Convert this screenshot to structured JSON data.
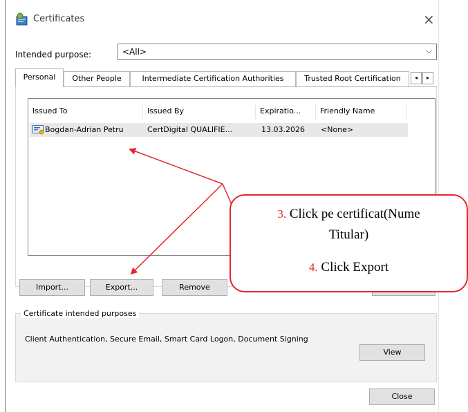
{
  "window": {
    "title": "Certificates",
    "close_glyph": "×"
  },
  "purpose": {
    "label": "Intended purpose:",
    "value": "<All>",
    "chevron": "⌵"
  },
  "tabs": [
    {
      "label": "Personal",
      "active": true
    },
    {
      "label": "Other People",
      "active": false
    },
    {
      "label": "Intermediate Certification Authorities",
      "active": false
    },
    {
      "label": "Trusted Root Certification",
      "active": false
    }
  ],
  "tab_scroll": {
    "left": "◂",
    "right": "▸"
  },
  "list": {
    "columns": [
      "Issued To",
      "Issued By",
      "Expiratio...",
      "Friendly Name"
    ],
    "rows": [
      {
        "issued_to": "Bogdan-Adrian Petru",
        "issued_by": "CertDigital QUALIFIE...",
        "expiration": "13.03.2026",
        "friendly_name": "<None>",
        "icon": "certificate-icon"
      }
    ]
  },
  "buttons": {
    "import": "Import...",
    "export": "Export...",
    "remove": "Remove",
    "view": "View",
    "close": "Close"
  },
  "purposes_group": {
    "legend": "Certificate intended purposes",
    "text": "Client Authentication, Secure Email, Smart Card Logon, Document Signing"
  },
  "callout": {
    "step3_num": "3.",
    "step3_text_a": "Click pe certificat(Nume",
    "step3_text_b": "Titular)",
    "step4_num": "4.",
    "step4_text": "Click Export"
  },
  "colors": {
    "annotation_red": "#e3262c"
  }
}
